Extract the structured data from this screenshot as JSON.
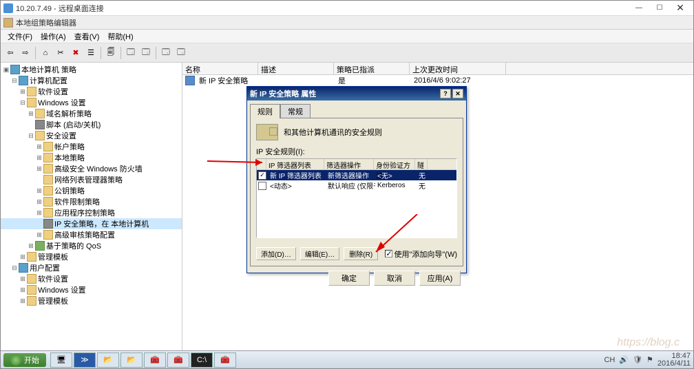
{
  "titlebar": {
    "title": "10.20.7.49 - 远程桌面连接"
  },
  "appwindow": {
    "title": "本地组策略编辑器"
  },
  "menus": [
    "文件(F)",
    "操作(A)",
    "查看(V)",
    "帮助(H)"
  ],
  "tree": {
    "root": "本地计算机 策略",
    "n1": "计算机配置",
    "n1a": "软件设置",
    "n1b": "Windows 设置",
    "n1b1": "域名解析策略",
    "n1b2": "脚本 (启动/关机)",
    "n1b3": "安全设置",
    "n1b3a": "帐户策略",
    "n1b3b": "本地策略",
    "n1b3c": "高级安全 Windows 防火墙",
    "n1b3d": "网络列表管理器策略",
    "n1b3e": "公钥策略",
    "n1b3f": "软件限制策略",
    "n1b3g": "应用程序控制策略",
    "n1b3h": "IP 安全策略，在 本地计算机",
    "n1b3i": "高级审核策略配置",
    "n1b4": "基于策略的 QoS",
    "n1c": "管理模板",
    "n2": "用户配置",
    "n2a": "软件设置",
    "n2b": "Windows 设置",
    "n2c": "管理模板"
  },
  "list": {
    "headers": {
      "name": "名称",
      "desc": "描述",
      "assigned": "策略已指派",
      "modified": "上次更改时间"
    },
    "row1": {
      "name": "新 IP 安全策略",
      "desc": "",
      "assigned": "是",
      "modified": "2016/4/6 9:02:27"
    }
  },
  "dialog": {
    "title": "新 IP 安全策略 属性",
    "tabs": {
      "rules": "规则",
      "general": "常规"
    },
    "desc": "和其他计算机通讯的安全规则",
    "group": "IP 安全规则(I):",
    "cols": {
      "filter": "IP 筛选器列表",
      "action": "筛选器操作",
      "auth": "身份验证方法",
      "tu": "隧"
    },
    "r1": {
      "filter": "新 IP 筛选器列表",
      "action": "新筛选器操作",
      "auth": "<无>",
      "tu": "无"
    },
    "r2": {
      "filter": "<动态>",
      "action": "默认响应 (仅限于…",
      "auth": "Kerberos",
      "tu": "无"
    },
    "buttons": {
      "add": "添加(D)…",
      "edit": "编辑(E)…",
      "delete": "删除(R)"
    },
    "wizard": "使用\"添加向导\"(W)",
    "ok": "确定",
    "cancel": "取消",
    "apply": "应用(A)"
  },
  "taskbar": {
    "start": "开始"
  },
  "tray": {
    "lang": "CH",
    "time": "18:47",
    "date": "2016/4/11"
  }
}
